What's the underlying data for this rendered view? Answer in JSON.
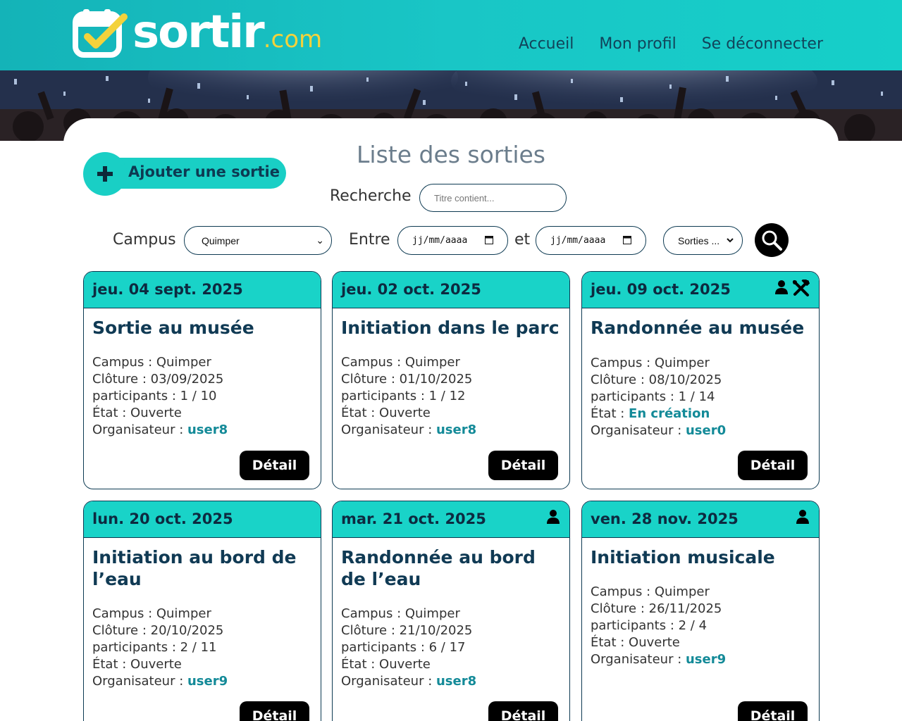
{
  "header": {
    "logo_text": "sortir",
    "logo_suffix": ".com",
    "nav": [
      "Accueil",
      "Mon profil",
      "Se déconnecter"
    ]
  },
  "page": {
    "title": "Liste des sorties",
    "add_button": "Ajouter une sortie"
  },
  "filters": {
    "search_label": "Recherche",
    "search_placeholder": "Titre contient...",
    "campus_label": "Campus",
    "campus_value": "Quimper",
    "between_label": "Entre",
    "and_label": "et",
    "date_placeholder_1": "jj/mm/aaaa",
    "date_placeholder_2": "jj/mm/aaaa",
    "sorties_select": "Sorties ..."
  },
  "cards": [
    {
      "date": "jeu. 04 sept. 2025",
      "title": "Sortie au musée",
      "campus_label": "Campus : ",
      "campus": "Quimper",
      "cloture_label": "Clôture : ",
      "cloture": "03/09/2025",
      "participants_label": "participants : ",
      "participants": "1 / 10",
      "etat_label": "État : ",
      "etat": "Ouverte",
      "organisateur_label": "Organisateur : ",
      "organisateur": "user8",
      "detail": "Détail"
    },
    {
      "date": "jeu. 02 oct. 2025",
      "title": "Initiation dans le parc",
      "campus_label": "Campus : ",
      "campus": "Quimper",
      "cloture_label": "Clôture : ",
      "cloture": "01/10/2025",
      "participants_label": "participants : ",
      "participants": "1 / 12",
      "etat_label": "État : ",
      "etat": "Ouverte",
      "organisateur_label": "Organisateur : ",
      "organisateur": "user8",
      "detail": "Détail"
    },
    {
      "date": "jeu. 09 oct. 2025",
      "title": "Randonnée au musée",
      "campus_label": "Campus : ",
      "campus": "Quimper",
      "cloture_label": "Clôture : ",
      "cloture": "08/10/2025",
      "participants_label": "participants : ",
      "participants": "1 / 14",
      "etat_label": "État : ",
      "etat": "En création",
      "organisateur_label": "Organisateur : ",
      "organisateur": "user0",
      "detail": "Détail"
    },
    {
      "date": "lun. 20 oct. 2025",
      "title": "Initiation au bord de l’eau",
      "campus_label": "Campus : ",
      "campus": "Quimper",
      "cloture_label": "Clôture : ",
      "cloture": "20/10/2025",
      "participants_label": "participants : ",
      "participants": "2 / 11",
      "etat_label": "État : ",
      "etat": "Ouverte",
      "organisateur_label": "Organisateur : ",
      "organisateur": "user9",
      "detail": "Détail"
    },
    {
      "date": "mar. 21 oct. 2025",
      "title": "Randonnée au bord de l’eau",
      "campus_label": "Campus : ",
      "campus": "Quimper",
      "cloture_label": "Clôture : ",
      "cloture": "21/10/2025",
      "participants_label": "participants : ",
      "participants": "6 / 17",
      "etat_label": "État : ",
      "etat": "Ouverte",
      "organisateur_label": "Organisateur : ",
      "organisateur": "user8",
      "detail": "Détail"
    },
    {
      "date": "ven. 28 nov. 2025",
      "title": "Initiation musicale",
      "campus_label": "Campus : ",
      "campus": "Quimper",
      "cloture_label": "Clôture : ",
      "cloture": "26/11/2025",
      "participants_label": "participants : ",
      "participants": "2 / 4",
      "etat_label": "État : ",
      "etat": "Ouverte",
      "organisateur_label": "Organisateur : ",
      "organisateur": "user9",
      "detail": "Détail"
    }
  ],
  "colors": {
    "accent": "#19d3c8",
    "dark": "#0d3a52",
    "link": "#138a98",
    "logo_yellow": "#f3d23b"
  },
  "icons": [
    "user-icon",
    "tools-icon",
    "search-icon",
    "plus-icon",
    "calendar-check-icon",
    "chevron-down-icon"
  ]
}
